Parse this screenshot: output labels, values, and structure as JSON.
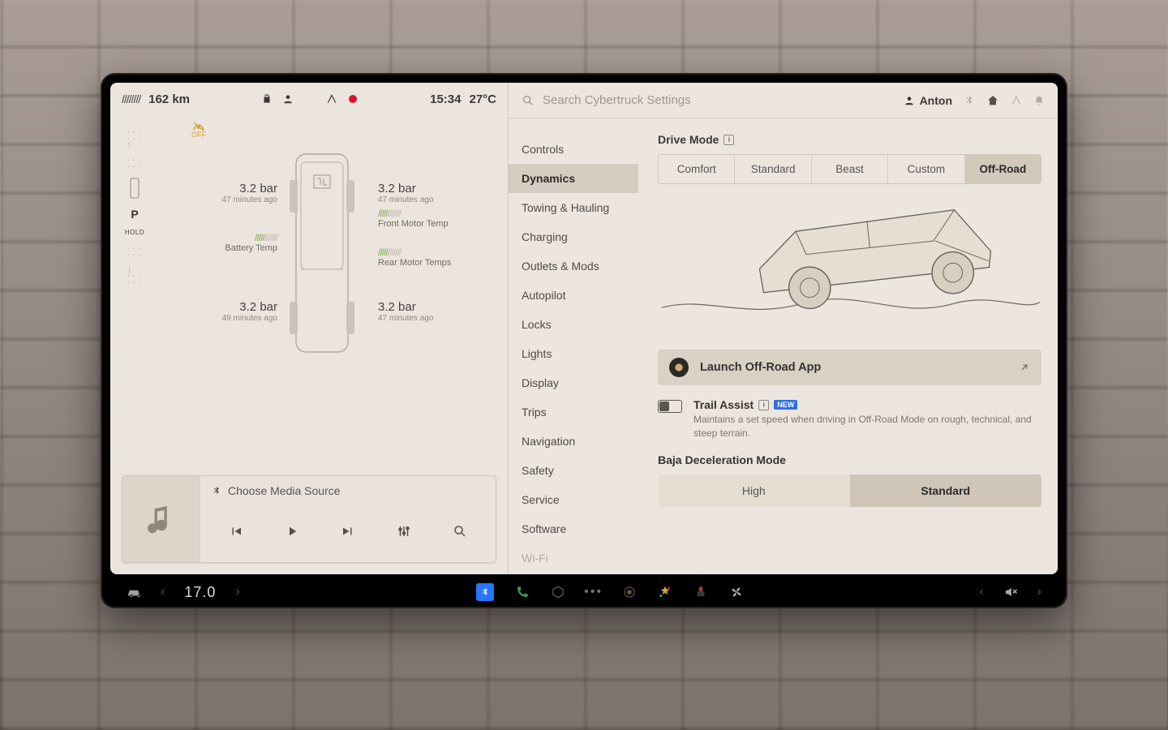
{
  "status": {
    "range": "162 km",
    "time": "15:34",
    "outside_temp": "27°C"
  },
  "gear": {
    "label": "P",
    "sub": "HOLD"
  },
  "traction": {
    "label": "OFF"
  },
  "tires": {
    "fl": {
      "pressure": "3.2 bar",
      "ago": "47 minutes ago"
    },
    "fr": {
      "pressure": "3.2 bar",
      "ago": "47 minutes ago"
    },
    "rl": {
      "pressure": "3.2 bar",
      "ago": "49 minutes ago"
    },
    "rr": {
      "pressure": "3.2 bar",
      "ago": "47 minutes ago"
    }
  },
  "temps": {
    "battery_label": "Battery Temp",
    "front_motor_label": "Front Motor Temp",
    "rear_motor_label": "Rear Motor Temps"
  },
  "media": {
    "title": "Choose Media Source"
  },
  "search": {
    "placeholder": "Search Cybertruck Settings"
  },
  "user": {
    "name": "Anton"
  },
  "nav": {
    "items": [
      "Controls",
      "Dynamics",
      "Towing & Hauling",
      "Charging",
      "Outlets & Mods",
      "Autopilot",
      "Locks",
      "Lights",
      "Display",
      "Trips",
      "Navigation",
      "Safety",
      "Service",
      "Software",
      "Wi-Fi"
    ],
    "active_index": 1
  },
  "drive_mode": {
    "title": "Drive Mode",
    "options": [
      "Comfort",
      "Standard",
      "Beast",
      "Custom",
      "Off-Road"
    ],
    "active_index": 4
  },
  "launch": {
    "label": "Launch Off-Road App"
  },
  "trail_assist": {
    "title": "Trail Assist",
    "badge": "NEW",
    "desc": "Maintains a set speed when driving in Off-Road Mode on rough, technical, and steep terrain."
  },
  "baja": {
    "title": "Baja Deceleration Mode",
    "options": [
      "High",
      "Standard"
    ],
    "active_index": 1
  },
  "dock": {
    "cabin_temp": "17.0"
  }
}
